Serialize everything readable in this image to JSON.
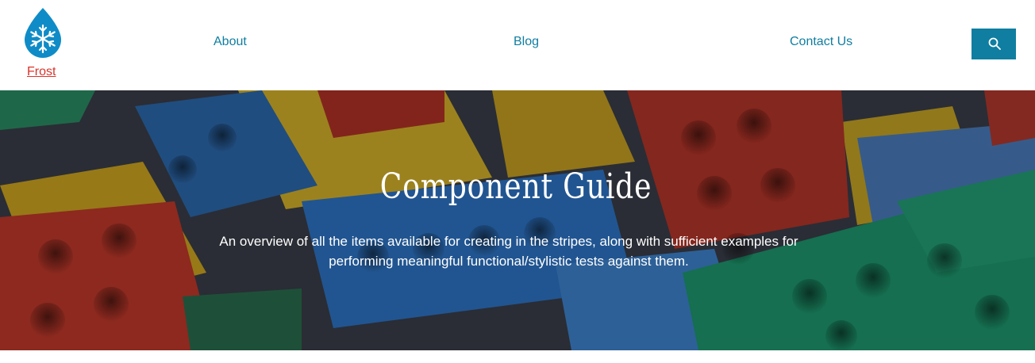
{
  "site": {
    "name": "Frost",
    "logo_icon": "snowflake-drop-icon"
  },
  "nav": {
    "items": [
      {
        "label": "About"
      },
      {
        "label": "Blog"
      },
      {
        "label": "Contact Us"
      }
    ],
    "search_icon": "search-icon"
  },
  "hero": {
    "title": "Component Guide",
    "subtitle": "An overview of all the items available for creating in the stripes, along with sufficient examples for performing meaningful functional/stylistic tests against them."
  },
  "colors": {
    "accent": "#0f7ea1",
    "logo_link": "#d9342b",
    "header_bg": "#ffffff",
    "hero_text": "#ffffff"
  }
}
